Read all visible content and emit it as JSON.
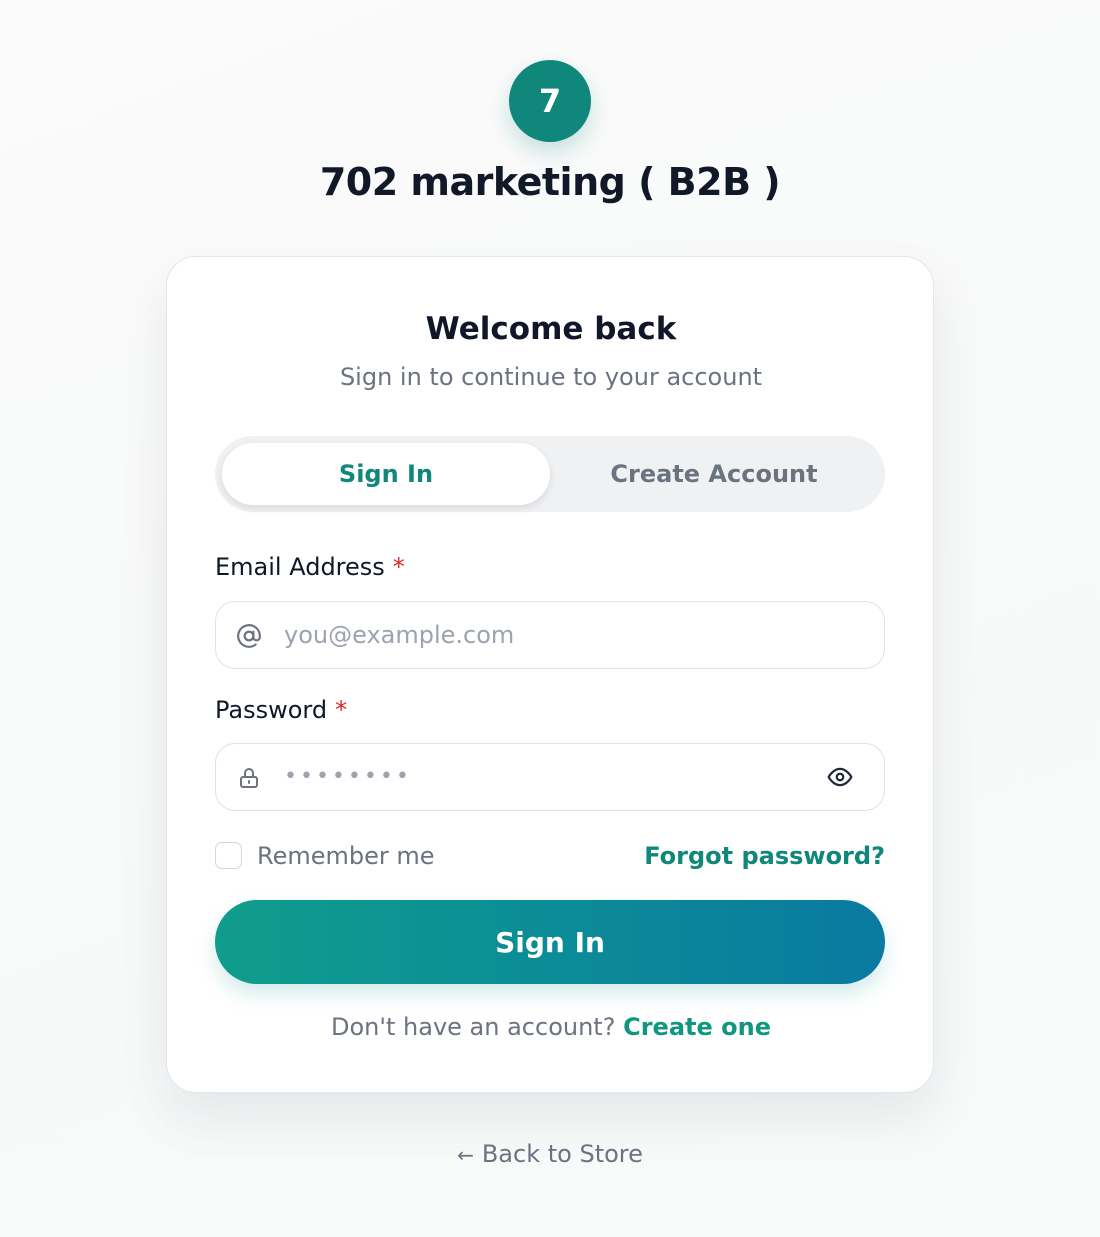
{
  "brand": {
    "logo_letter": "7",
    "store_name": "702 marketing ( B2B )",
    "accent_color": "#10877b"
  },
  "card": {
    "title": "Welcome back",
    "subtitle": "Sign in to continue to your account"
  },
  "tabs": [
    {
      "label": "Sign In",
      "active": true
    },
    {
      "label": "Create Account",
      "active": false
    }
  ],
  "form": {
    "email": {
      "label": "Email Address",
      "required_mark": "*",
      "placeholder": "you@example.com",
      "value": "",
      "icon": "at-icon"
    },
    "password": {
      "label": "Password",
      "required_mark": "*",
      "placeholder": "••••••••",
      "value": "",
      "icon": "lock-icon",
      "toggle_icon": "eye-icon"
    },
    "remember_label": "Remember me",
    "remember_checked": false,
    "forgot_label": "Forgot password?",
    "submit_label": "Sign In"
  },
  "footer": {
    "prompt": "Don't have an account?",
    "link": "Create one"
  },
  "back": {
    "arrow": "←",
    "label": "Back to Store"
  }
}
